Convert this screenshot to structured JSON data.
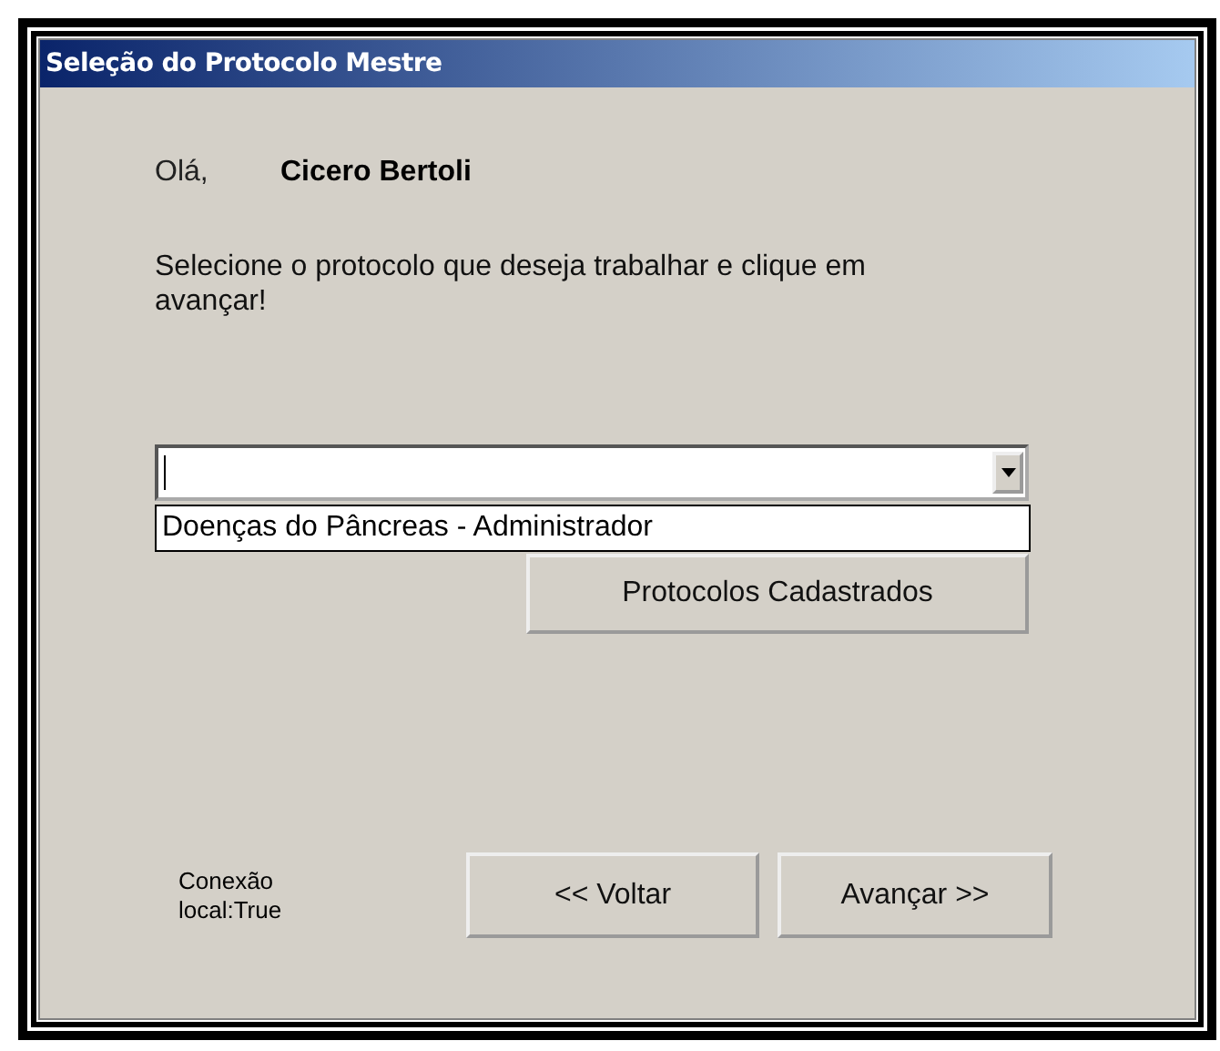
{
  "window": {
    "title": "Seleção do Protocolo Mestre"
  },
  "greeting": {
    "label": "Olá,",
    "user_name": "Cicero Bertoli"
  },
  "instruction": "Selecione o protocolo que deseja trabalhar e clique em avançar!",
  "protocol_combo": {
    "items": [
      {
        "label": "Doenças do Pâncreas - Administrador",
        "selected": false
      }
    ]
  },
  "registered_button": "Protocolos Cadastrados",
  "connection_status": "Conexão local:True",
  "buttons": [
    {
      "label": "<< Voltar"
    },
    {
      "label": "Avançar >>"
    }
  ]
}
